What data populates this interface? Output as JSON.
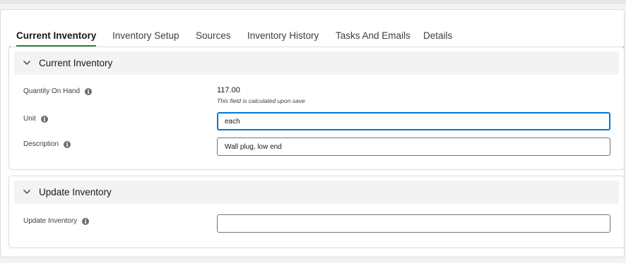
{
  "tabs": [
    {
      "label": "Current Inventory",
      "active": true
    },
    {
      "label": "Inventory Setup"
    },
    {
      "label": "Sources"
    },
    {
      "label": "Inventory History"
    },
    {
      "label": "Tasks And Emails"
    },
    {
      "label": "Details"
    }
  ],
  "current_section": {
    "title": "Current Inventory",
    "quantity_label": "Quantity On Hand",
    "quantity_value": "117.00",
    "quantity_help": "This field is calculated upon save",
    "unit_label": "Unit",
    "unit_value": "each",
    "description_label": "Description",
    "description_value": "Wall plug, low end"
  },
  "update_section": {
    "title": "Update Inventory",
    "update_label": "Update Inventory",
    "update_value": ""
  },
  "colors": {
    "active_tab_underline": "#2e844a",
    "focus_border": "#0176d3",
    "section_header_bg": "#f3f3f3"
  },
  "icons": {
    "section_toggle": "chevron-down-icon",
    "field_help": "info-icon"
  }
}
